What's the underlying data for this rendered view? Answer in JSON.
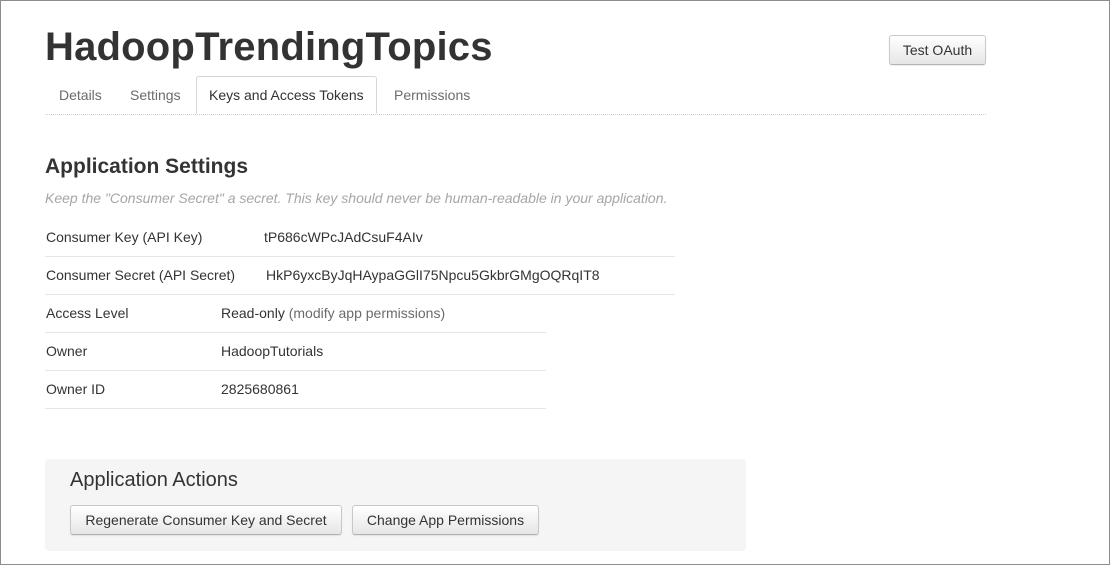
{
  "app": {
    "title": "HadoopTrendingTopics"
  },
  "header": {
    "test_oauth_label": "Test OAuth"
  },
  "tabs": [
    {
      "label": "Details"
    },
    {
      "label": "Settings"
    },
    {
      "label": "Keys and Access Tokens",
      "active": true
    },
    {
      "label": "Permissions"
    }
  ],
  "settings": {
    "title": "Application Settings",
    "subtitle": "Keep the \"Consumer Secret\" a secret. This key should never be human-readable in your application.",
    "rows": [
      {
        "label": "Consumer Key (API Key)",
        "value": "tP686cWPcJAdCsuF4AIv"
      },
      {
        "label": "Consumer Secret (API Secret)",
        "value": "HkP6yxcByJqHAypaGGlI75Npcu5GkbrGMgOQRqIT8"
      },
      {
        "label": "Access Level",
        "value": "Read-only",
        "link_open": "(",
        "link": "modify app permissions",
        "link_close": ")"
      },
      {
        "label": "Owner",
        "value": "HadoopTutorials"
      },
      {
        "label": "Owner ID",
        "value": "2825680861"
      }
    ]
  },
  "actions": {
    "title": "Application Actions",
    "regenerate_label": "Regenerate Consumer Key and Secret",
    "change_permissions_label": "Change App Permissions"
  }
}
